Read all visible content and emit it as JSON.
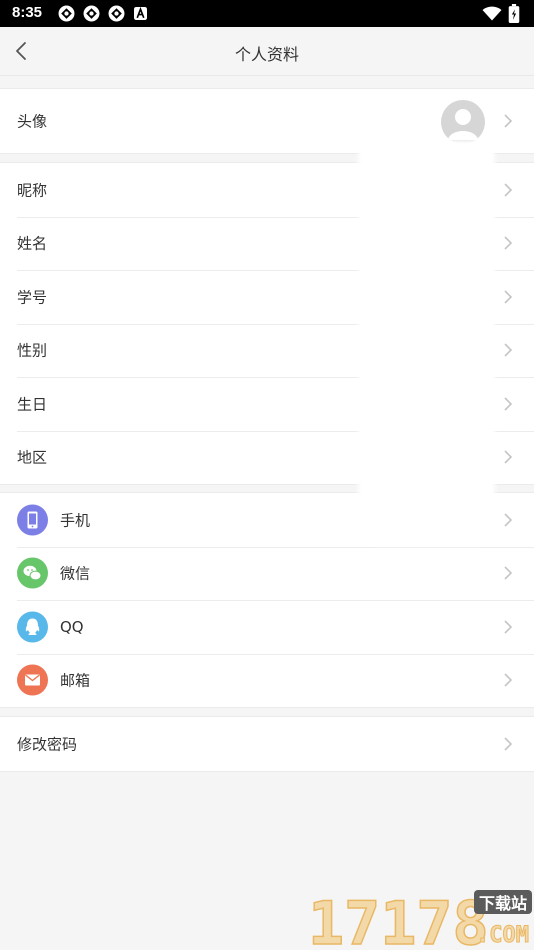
{
  "status_bar": {
    "time": "8:35"
  },
  "header": {
    "title": "个人资料"
  },
  "profile": {
    "avatar_label": "头像",
    "fields": [
      {
        "label": "昵称"
      },
      {
        "label": "姓名"
      },
      {
        "label": "学号"
      },
      {
        "label": "性别"
      },
      {
        "label": "生日"
      },
      {
        "label": "地区"
      }
    ]
  },
  "accounts": [
    {
      "label": "手机",
      "icon": "phone-icon",
      "color": "#7b7fe6"
    },
    {
      "label": "微信",
      "icon": "wechat-icon",
      "color": "#67c56a"
    },
    {
      "label": "QQ",
      "icon": "qq-icon",
      "color": "#58b8e9"
    },
    {
      "label": "邮箱",
      "icon": "mail-icon",
      "color": "#ee7453"
    }
  ],
  "security": {
    "change_password_label": "修改密码"
  },
  "watermark": {
    "number": "17178",
    "site": "下载站",
    "domain": ".COM"
  },
  "colors": {
    "background": "#f5f5f5",
    "row": "#ffffff",
    "chevron": "#c4c4c4"
  }
}
